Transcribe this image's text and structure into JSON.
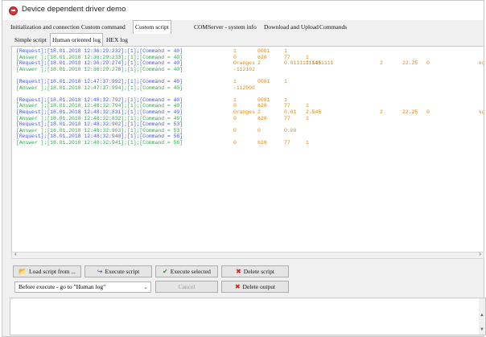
{
  "window": {
    "title": "Device dependent driver demo"
  },
  "main_tabs": [
    "Initialization and connection",
    "Custom command",
    "Custom script",
    "COMServer - system info",
    "Download and Upload",
    "Commands"
  ],
  "active_main_tab": "Custom script",
  "sub_tabs": [
    "Simple script",
    "Human oriented log",
    "HEX log"
  ],
  "active_sub_tab": "Human oriented log",
  "log": [
    {
      "type": "request",
      "prefix": "[Request];[18.01.2018 12:36:29:232];[1];[Command = 40]",
      "cols": [
        "1",
        "0001",
        "1",
        "",
        "",
        "",
        "",
        ""
      ]
    },
    {
      "type": "answer",
      "prefix": "[Answer ];[18.01.2018 12:36:29:233];[1];[Command = 40]",
      "cols": [
        "0",
        "620",
        "77",
        "1",
        "",
        "",
        "",
        ""
      ]
    },
    {
      "type": "request",
      "prefix": "[Request];[18.01.2018 12:36:29:274];[1];[Command = 40]",
      "cols": [
        "Oranges",
        "2",
        "0.01111111111111",
        "2.545",
        "2",
        "22.25",
        "0",
        "kg"
      ]
    },
    {
      "type": "answer",
      "prefix": "[Answer ];[18.01.2018 12:36:29:278];[1];[Command = 40]",
      "cols": [
        "-112102",
        "",
        "",
        "",
        "",
        "",
        "",
        ""
      ]
    },
    {
      "type": "gap"
    },
    {
      "type": "request",
      "prefix": "[Request];[18.01.2018 12:47:37:992];[1];[Command = 40]",
      "cols": [
        "1",
        "0001",
        "1",
        "",
        "",
        "",
        "",
        ""
      ]
    },
    {
      "type": "answer",
      "prefix": "[Answer ];[18.01.2018 12:47:37:994];[1];[Command = 40]",
      "cols": [
        "-112000",
        "",
        "",
        "",
        "",
        "",
        "",
        ""
      ]
    },
    {
      "type": "gap"
    },
    {
      "type": "request",
      "prefix": "[Request];[18.01.2018 12:48:32:792];[1];[Command = 40]",
      "cols": [
        "1",
        "0001",
        "1",
        "",
        "",
        "",
        "",
        ""
      ]
    },
    {
      "type": "answer",
      "prefix": "[Answer ];[18.01.2018 12:48:32:794];[1];[Command = 40]",
      "cols": [
        "0",
        "620",
        "77",
        "1",
        "",
        "",
        "",
        ""
      ]
    },
    {
      "type": "request",
      "prefix": "[Request];[18.01.2018 12:48:32:831];[1];[Command = 49]",
      "cols": [
        "Oranges",
        "2",
        "0.01",
        "2.545",
        "2",
        "22.25",
        "0",
        "kg"
      ]
    },
    {
      "type": "answer",
      "prefix": "[Answer ];[18.01.2018 12:48:32:832];[1];[Command = 49]",
      "cols": [
        "0",
        "620",
        "77",
        "1",
        "",
        "",
        "",
        ""
      ]
    },
    {
      "type": "request",
      "prefix": "[Request];[18.01.2018 12:48:32:902];[1];[Command = 53]",
      "cols": [
        "",
        "",
        "",
        "",
        "",
        "",
        "",
        ""
      ]
    },
    {
      "type": "answer",
      "prefix": "[Answer ];[18.01.2018 12:48:32:903];[1];[Command = 53]",
      "cols": [
        "0",
        "0",
        "0.00",
        "",
        "",
        "",
        "",
        ""
      ]
    },
    {
      "type": "request",
      "prefix": "[Request];[18.01.2018 12:48:32:940];[1];[Command = 56]",
      "cols": [
        "",
        "",
        "",
        "",
        "",
        "",
        "",
        ""
      ]
    },
    {
      "type": "answer",
      "prefix": "[Answer ];[18.01.2018 12:48:32:941];[1];[Command = 56]",
      "cols": [
        "0",
        "620",
        "77",
        "1",
        "",
        "",
        "",
        ""
      ]
    }
  ],
  "buttons": {
    "load_script": "Load script from ...",
    "execute_script": "Execute script",
    "execute_selected": "Execute selected",
    "delete_script": "Delete script",
    "cancel": "Cancel",
    "delete_output": "Delete output"
  },
  "after_execute_select": "Before execute - go to \"Human log\"",
  "colors": {
    "request": "#4a5bd8",
    "answer": "#3aa457",
    "values": "#d98b1c"
  }
}
